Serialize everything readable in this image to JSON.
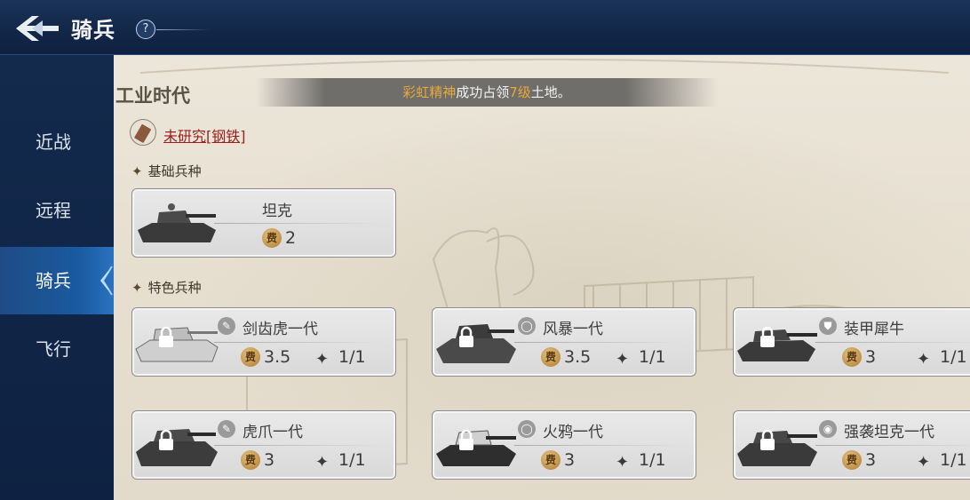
{
  "header": {
    "title": "骑兵",
    "help_label": "?"
  },
  "sidebar": {
    "items": [
      {
        "label": "近战",
        "active": false
      },
      {
        "label": "远程",
        "active": false
      },
      {
        "label": "骑兵",
        "active": true
      },
      {
        "label": "飞行",
        "active": false
      }
    ]
  },
  "content": {
    "era_title": "工业时代",
    "notice": {
      "player": "彩虹精神",
      "text1": "成功占领",
      "level": "7级",
      "text2": "土地。"
    },
    "research_label": "未研究[钢铁]",
    "basic_section": "基础兵种",
    "special_section": "特色兵种",
    "basic_units": [
      {
        "name": "坦克",
        "cost": "2",
        "cost_icon": "费",
        "locked": false
      }
    ],
    "special_units": [
      {
        "name": "剑齿虎一代",
        "icon": "sword-icon",
        "cost": "3.5",
        "limit": "1/1",
        "cost_icon": "费",
        "locked": true
      },
      {
        "name": "风暴一代",
        "icon": "shield-round-icon",
        "cost": "3.5",
        "limit": "1/1",
        "cost_icon": "费",
        "locked": true
      },
      {
        "name": "装甲犀牛",
        "icon": "shield-icon",
        "cost": "3",
        "limit": "1/1",
        "cost_icon": "费",
        "locked": true
      },
      {
        "name": "虎爪一代",
        "icon": "sword-icon",
        "cost": "3",
        "limit": "1/1",
        "cost_icon": "费",
        "locked": true
      },
      {
        "name": "火鸦一代",
        "icon": "shield-round-icon",
        "cost": "3",
        "limit": "1/1",
        "cost_icon": "费",
        "locked": true
      },
      {
        "name": "强袭坦克一代",
        "icon": "boot-icon",
        "cost": "3",
        "limit": "1/1",
        "cost_icon": "费",
        "locked": true
      }
    ]
  }
}
